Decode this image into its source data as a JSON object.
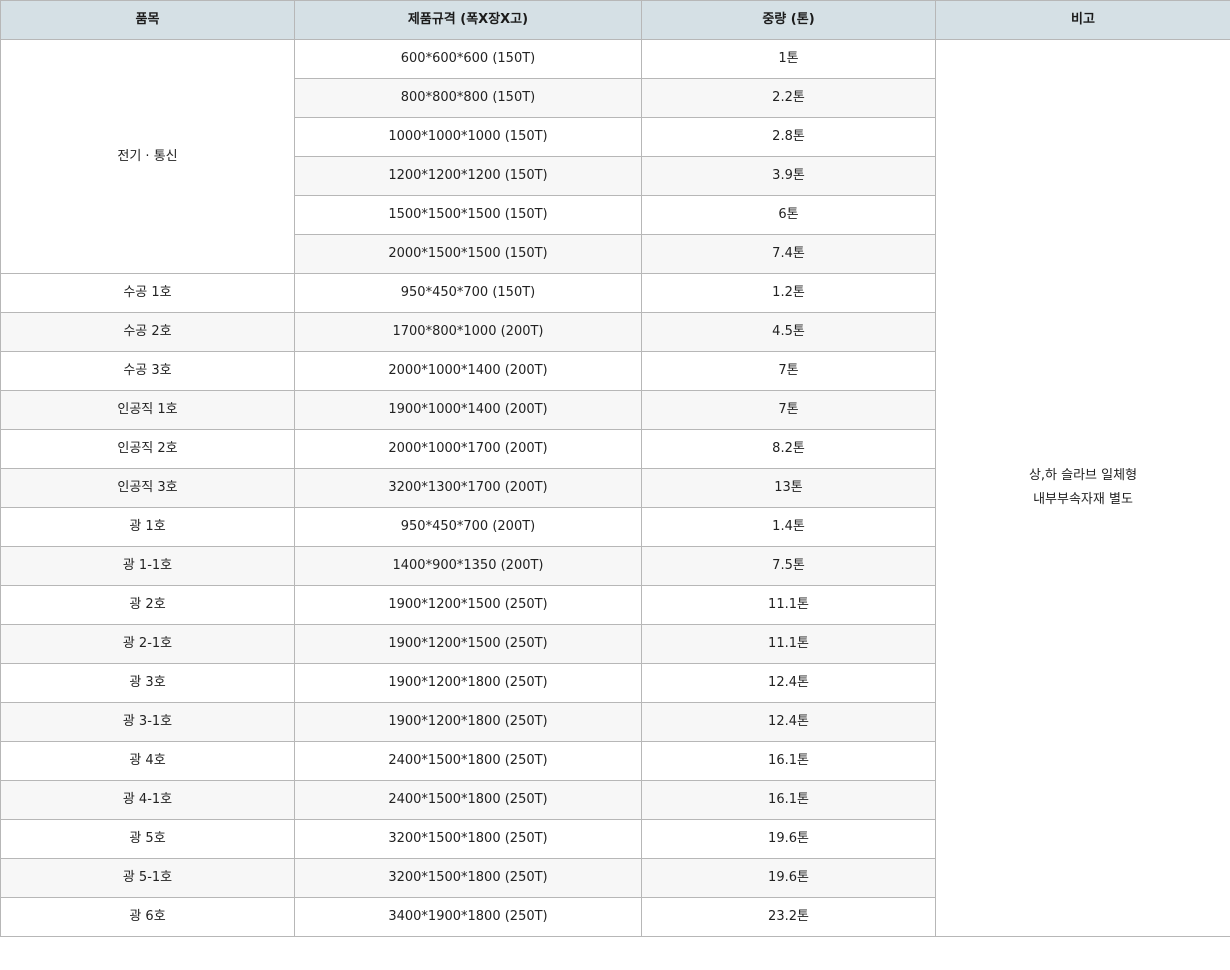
{
  "table": {
    "headers": [
      "품목",
      "제품규격 (폭X장X고)",
      "중량 (톤)",
      "비고"
    ],
    "merged_item": "전기 · 통신",
    "note_lines": [
      "상,하 슬라브 일체형",
      "내부부속자재 별도"
    ],
    "rows": [
      {
        "item": "",
        "spec": "600*600*600 (150T)",
        "weight": "1톤"
      },
      {
        "item": "",
        "spec": "800*800*800 (150T)",
        "weight": "2.2톤"
      },
      {
        "item": "",
        "spec": "1000*1000*1000 (150T)",
        "weight": "2.8톤"
      },
      {
        "item": "",
        "spec": "1200*1200*1200 (150T)",
        "weight": "3.9톤"
      },
      {
        "item": "",
        "spec": "1500*1500*1500 (150T)",
        "weight": "6톤"
      },
      {
        "item": "",
        "spec": "2000*1500*1500 (150T)",
        "weight": "7.4톤"
      },
      {
        "item": "수공 1호",
        "spec": "950*450*700 (150T)",
        "weight": "1.2톤"
      },
      {
        "item": "수공 2호",
        "spec": "1700*800*1000 (200T)",
        "weight": "4.5톤"
      },
      {
        "item": "수공 3호",
        "spec": "2000*1000*1400 (200T)",
        "weight": "7톤"
      },
      {
        "item": "인공직 1호",
        "spec": "1900*1000*1400 (200T)",
        "weight": "7톤"
      },
      {
        "item": "인공직 2호",
        "spec": "2000*1000*1700 (200T)",
        "weight": "8.2톤"
      },
      {
        "item": "인공직 3호",
        "spec": "3200*1300*1700 (200T)",
        "weight": "13톤"
      },
      {
        "item": "광 1호",
        "spec": "950*450*700 (200T)",
        "weight": "1.4톤"
      },
      {
        "item": "광 1-1호",
        "spec": "1400*900*1350 (200T)",
        "weight": "7.5톤"
      },
      {
        "item": "광 2호",
        "spec": "1900*1200*1500 (250T)",
        "weight": "11.1톤"
      },
      {
        "item": "광 2-1호",
        "spec": "1900*1200*1500 (250T)",
        "weight": "11.1톤"
      },
      {
        "item": "광 3호",
        "spec": "1900*1200*1800 (250T)",
        "weight": "12.4톤"
      },
      {
        "item": "광 3-1호",
        "spec": "1900*1200*1800 (250T)",
        "weight": "12.4톤"
      },
      {
        "item": "광 4호",
        "spec": "2400*1500*1800 (250T)",
        "weight": "16.1톤"
      },
      {
        "item": "광 4-1호",
        "spec": "2400*1500*1800 (250T)",
        "weight": "16.1톤"
      },
      {
        "item": "광 5호",
        "spec": "3200*1500*1800 (250T)",
        "weight": "19.6톤"
      },
      {
        "item": "광 5-1호",
        "spec": "3200*1500*1800 (250T)",
        "weight": "19.6톤"
      },
      {
        "item": "광 6호",
        "spec": "3400*1900*1800 (250T)",
        "weight": "23.2톤"
      }
    ]
  },
  "colors": {
    "header_bg": "#d5e0e5",
    "alt_row_bg": "#f7f7f7",
    "border": "#b7b7b7"
  }
}
